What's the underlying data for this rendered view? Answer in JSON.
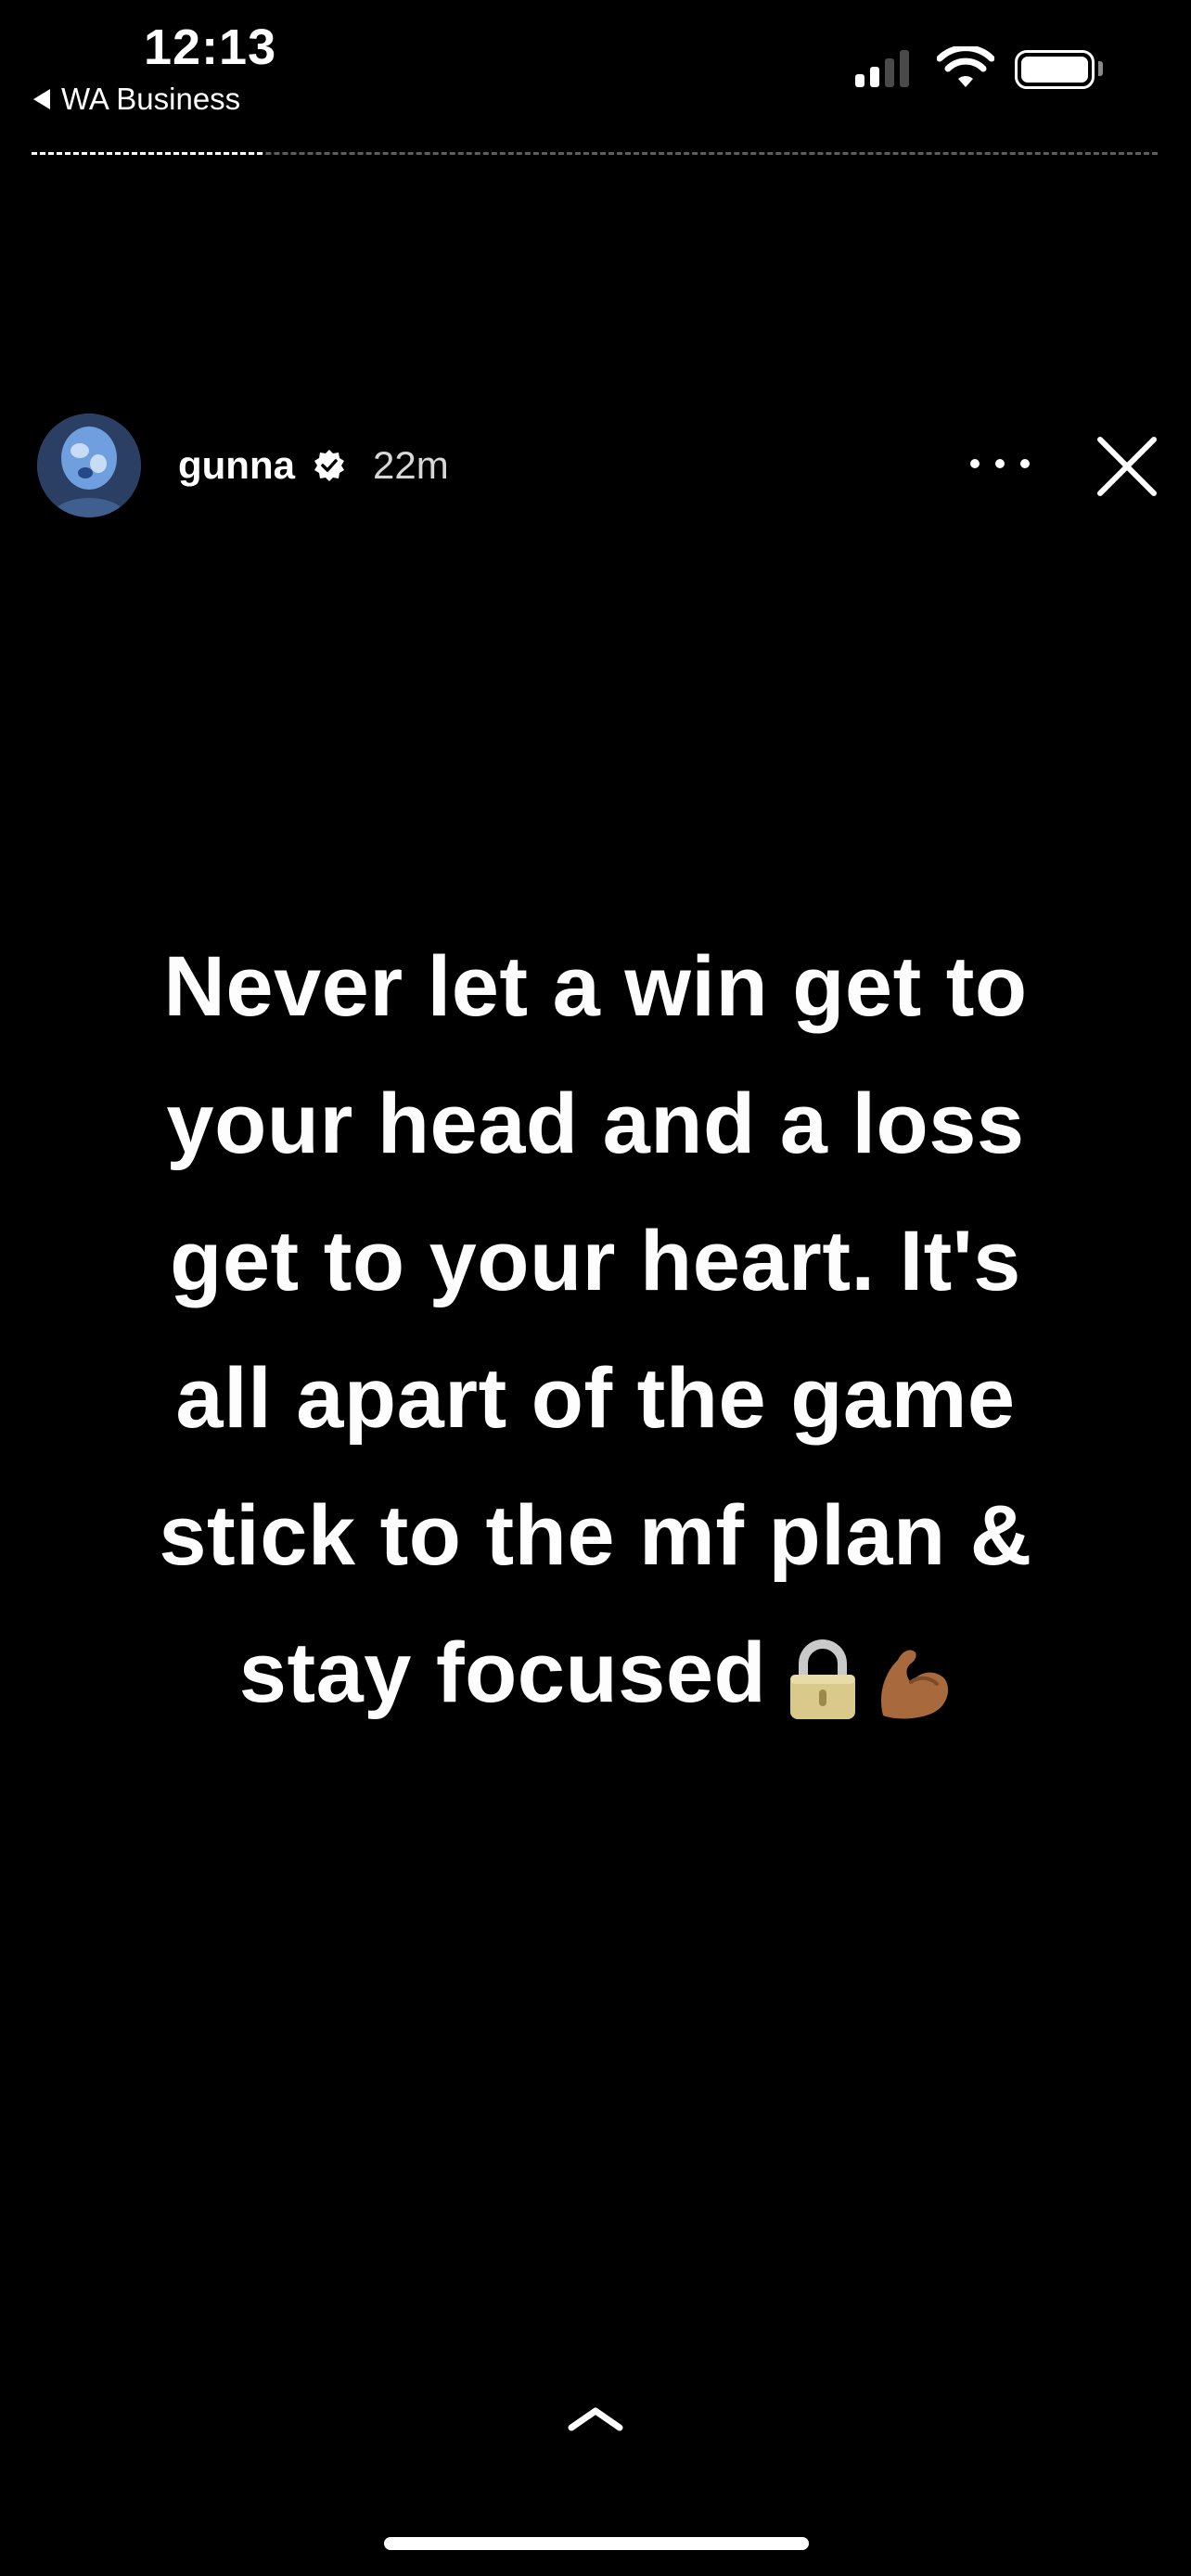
{
  "status_bar": {
    "time": "12:13",
    "back_app": "WA Business",
    "signal_bars_active": 2,
    "signal_bars_total": 4,
    "battery_level": 1.0
  },
  "progress": {
    "fraction": 0.205
  },
  "story": {
    "username": "gunna",
    "verified": true,
    "timestamp": "22m",
    "text_lines": [
      "Never let a win get to",
      "your head and a loss",
      "get to your heart. It's",
      "all apart of the game",
      "stick to the mf plan &",
      "stay focused"
    ],
    "emojis": [
      "lock-icon",
      "flexed-biceps-icon"
    ]
  },
  "icons": {
    "verified": "verified-badge-icon",
    "more": "ellipsis-icon",
    "close": "close-icon",
    "swipe_up": "chevron-up-icon"
  },
  "colors": {
    "background": "#000000",
    "text": "#ffffff",
    "timestamp": "#d7d7d7",
    "progress_track": "#5d5d5d"
  }
}
